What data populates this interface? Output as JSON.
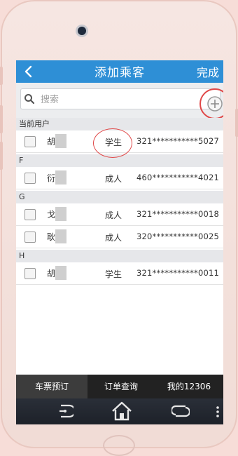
{
  "header": {
    "title": "添加乘客",
    "done_label": "完成"
  },
  "search": {
    "placeholder": "搜索"
  },
  "sections": [
    {
      "header": "当前用户",
      "rows": [
        {
          "name": "胡",
          "type": "学生",
          "id": "321***********5027"
        }
      ]
    },
    {
      "header": "F",
      "rows": [
        {
          "name": "衍",
          "type": "成人",
          "id": "460***********4021"
        }
      ]
    },
    {
      "header": "G",
      "rows": [
        {
          "name": "戈",
          "type": "成人",
          "id": "321***********0018"
        },
        {
          "name": "耿",
          "type": "成人",
          "id": "320***********0025"
        }
      ]
    },
    {
      "header": "H",
      "rows": [
        {
          "name": "胡",
          "type": "学生",
          "id": "321***********0011"
        }
      ]
    }
  ],
  "tabs": [
    {
      "label": "车票预订",
      "active": true
    },
    {
      "label": "订单查询",
      "active": false
    },
    {
      "label": "我的12306",
      "active": false
    }
  ],
  "colors": {
    "header_bg": "#2e8fd6",
    "annotation": "#e04848",
    "tab_bg": "#222222"
  },
  "icons": [
    "back-arrow-icon",
    "search-icon",
    "add-passenger-icon",
    "nav-back-icon",
    "nav-home-icon",
    "nav-recent-icon"
  ]
}
